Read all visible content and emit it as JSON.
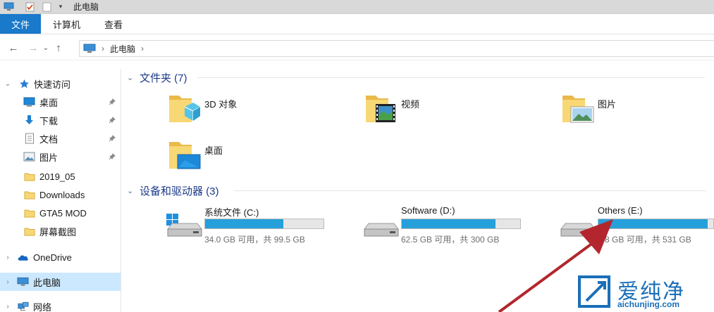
{
  "window": {
    "title": "此电脑"
  },
  "ribbon": {
    "tabs": [
      "文件",
      "计算机",
      "查看"
    ]
  },
  "address": {
    "path": "此电脑"
  },
  "sidebar": {
    "quick_access": "快速访问",
    "items": [
      {
        "label": "桌面",
        "icon": "desktop-icon",
        "pinned": true
      },
      {
        "label": "下载",
        "icon": "download-icon",
        "pinned": true
      },
      {
        "label": "文档",
        "icon": "document-icon",
        "pinned": true
      },
      {
        "label": "图片",
        "icon": "picture-icon",
        "pinned": true
      },
      {
        "label": "2019_05",
        "icon": "folder-icon",
        "pinned": false
      },
      {
        "label": "Downloads",
        "icon": "folder-icon",
        "pinned": false
      },
      {
        "label": "GTA5 MOD",
        "icon": "folder-icon",
        "pinned": false
      },
      {
        "label": "屏幕截图",
        "icon": "folder-icon",
        "pinned": false
      }
    ],
    "onedrive": "OneDrive",
    "this_pc": "此电脑",
    "network": "网络"
  },
  "folders_group": {
    "header": "文件夹 (7)",
    "items": [
      {
        "label": "3D 对象",
        "icon": "3d-objects-folder-icon"
      },
      {
        "label": "视频",
        "icon": "videos-folder-icon"
      },
      {
        "label": "图片",
        "icon": "pictures-folder-icon"
      },
      {
        "label": "桌面",
        "icon": "desktop-folder-icon"
      }
    ]
  },
  "drives_group": {
    "header": "设备和驱动器 (3)",
    "items": [
      {
        "name": "系统文件 (C:)",
        "info": "34.0 GB 可用，共 99.5 GB",
        "used_fraction": 0.66,
        "icon": "windows-drive-icon"
      },
      {
        "name": "Software (D:)",
        "info": "62.5 GB 可用，共 300 GB",
        "used_fraction": 0.79,
        "icon": "hard-drive-icon"
      },
      {
        "name": "Others (E:)",
        "info": "2.8 GB 可用，共 531 GB",
        "used_fraction": 0.95,
        "icon": "hard-drive-icon"
      }
    ]
  },
  "watermark": {
    "text": "爱纯净",
    "url": "aichunjing.com"
  },
  "colors": {
    "accent": "#1979ca",
    "progress": "#26a0da",
    "selected": "#cce8ff",
    "group_header": "#1e3b8a",
    "arrow": "#b3262d"
  }
}
